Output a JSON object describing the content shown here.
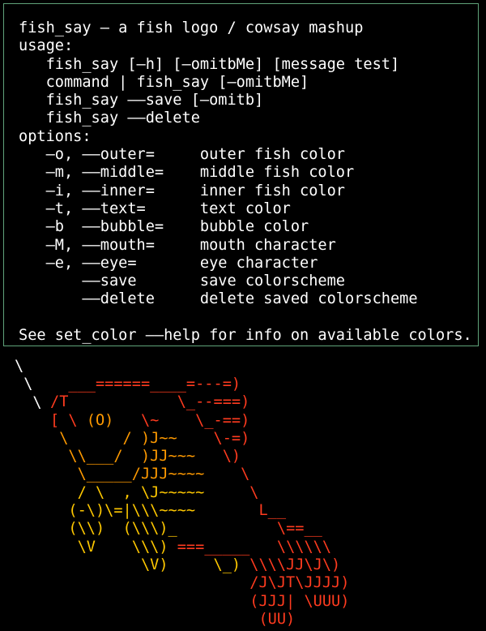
{
  "bubble": {
    "lines": [
      "fish_say — a fish logo / cowsay mashup",
      "usage:",
      "   fish_say [—h] [—omitbMe] [message test]",
      "   command | fish_say [—omitbMe]",
      "   fish_say ——save [—omitb]",
      "   fish_say ——delete",
      "options:",
      "   —o, ——outer=     outer fish color",
      "   —m, ——middle=    middle fish color",
      "   —i, ——inner=     inner fish color",
      "   —t, ——text=      text color",
      "   —b  ——bubble=    bubble color",
      "   —M, ——mouth=     mouth character",
      "   —e, ——eye=       eye character",
      "       ——save       save colorscheme",
      "       ——delete     delete saved colorscheme",
      "",
      "See set_color ——help for info on available colors."
    ]
  },
  "tail": {
    "lines": [
      "\\",
      " \\",
      "  \\"
    ]
  },
  "fish": {
    "lines": [
      [
        {
          "c": "outer",
          "t": "  ___======____=---=)"
        }
      ],
      [
        {
          "c": "outer",
          "t": "/T            \\_--===)"
        }
      ],
      [
        {
          "c": "outer",
          "t": "[ \\ "
        },
        {
          "c": "mid",
          "t": "(O)"
        },
        {
          "c": "outer",
          "t": "   \\~    \\_-==)"
        }
      ],
      [
        {
          "c": "mid",
          "t": " \\      / )J~~"
        },
        {
          "c": "outer",
          "t": "    \\-=)"
        }
      ],
      [
        {
          "c": "mid",
          "t": "  \\\\___/  )JJ~~~"
        },
        {
          "c": "outer",
          "t": "   \\)"
        }
      ],
      [
        {
          "c": "mid",
          "t": "   \\_____/JJJ~~~~"
        },
        {
          "c": "outer",
          "t": "    \\"
        }
      ],
      [
        {
          "c": "inner",
          "t": "   / \\  , \\J~~~~~"
        },
        {
          "c": "outer",
          "t": "     \\"
        }
      ],
      [
        {
          "c": "inner",
          "t": "  (-\\)\\=|\\\\\\~~~~"
        },
        {
          "c": "outer",
          "t": "       L__"
        }
      ],
      [
        {
          "c": "inner",
          "t": "  (\\\\)  (\\\\\\)_"
        },
        {
          "c": "outer",
          "t": "           \\==__"
        }
      ],
      [
        {
          "c": "inner",
          "t": "   \\V    \\\\\\) "
        },
        {
          "c": "outer",
          "t": "===_____   \\\\\\\\\\\\"
        }
      ],
      [
        {
          "c": "inner",
          "t": "          \\V)     \\_) "
        },
        {
          "c": "outer",
          "t": "\\\\\\\\JJ\\J\\)"
        }
      ],
      [
        {
          "c": "outer",
          "t": "                      /J\\JT\\JJJJ)"
        }
      ],
      [
        {
          "c": "outer",
          "t": "                      (JJJ| \\UUU)"
        }
      ],
      [
        {
          "c": "outer",
          "t": "                       (UU)"
        }
      ]
    ]
  },
  "colors": {
    "background": "#000000",
    "text": "#ffffff",
    "bubble_border": "#5fa37a",
    "outer": "#ff3b1f",
    "middle": "#ff9a00",
    "inner": "#ffc800"
  }
}
